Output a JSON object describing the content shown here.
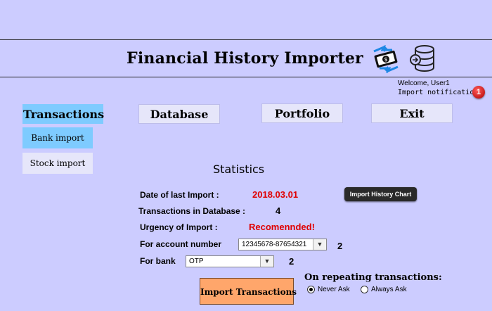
{
  "header": {
    "title": "Financial History Importer",
    "icons": [
      "money-transfer-icon",
      "database-icon"
    ]
  },
  "user": {
    "welcome": "Welcome, User1",
    "notification": "Import notification",
    "notification_count": "1"
  },
  "nav": {
    "transactions": "Transactions",
    "database": "Database",
    "portfolio": "Portfolio",
    "exit": "Exit"
  },
  "subnav": {
    "bank_import": "Bank import",
    "stock_import": "Stock import"
  },
  "statistics": {
    "heading": "Statistics",
    "last_import_label": "Date of last Import :",
    "last_import_value": "2018.03.01",
    "chart_button": "Import History Chart",
    "tx_in_db_label": "Transactions in Database :",
    "tx_in_db_value": "4",
    "urgency_label": "Urgency of Import :",
    "urgency_value": "Recomennded!"
  },
  "account": {
    "label": "For account number",
    "selected": "12345678-87654321",
    "count": "2"
  },
  "bank": {
    "label": "For bank",
    "selected": "OTP",
    "count": "2"
  },
  "import_button": "Import Transactions",
  "repeating": {
    "title": "On repeating transactions:",
    "options": [
      "Never Ask",
      "Always Ask"
    ],
    "selected": "Never Ask"
  },
  "colors": {
    "background": "#ccccff",
    "active_tab": "#7ecbff",
    "alert_red": "#e00000",
    "import_button": "#ffa66b"
  }
}
